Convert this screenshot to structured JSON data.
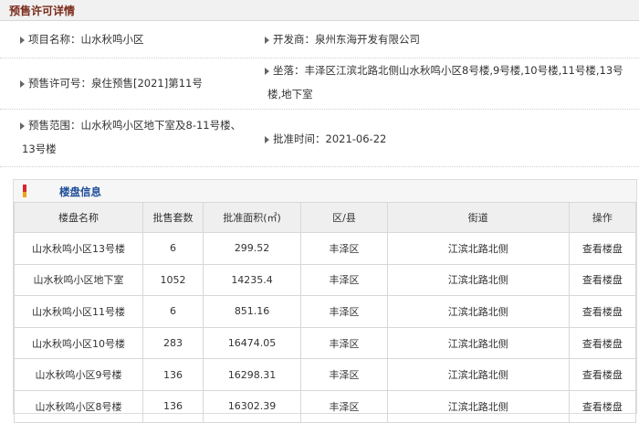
{
  "header": {
    "title": "预售许可详情"
  },
  "details": {
    "project_name_label": "项目名称：",
    "project_name": "山水秋鸣小区",
    "developer_label": "开发商：",
    "developer": "泉州东海开发有限公司",
    "permit_no_label": "预售许可号：",
    "permit_no": "泉住预售[2021]第11号",
    "location_label": "坐落：",
    "location_line1": "丰泽区江滨北路北侧山水秋鸣小区8号楼,9号楼,10号楼,11号楼,13号",
    "location_line2": "楼,地下室",
    "scope_label": "预售范围：",
    "scope_line1": "山水秋鸣小区地下室及8-11号楼、",
    "scope_line2": "13号楼",
    "approval_label": "批准时间：",
    "approval_date": "2021-06-22"
  },
  "listing": {
    "title": "楼盘信息",
    "columns": [
      "楼盘名称",
      "批售套数",
      "批准面积(㎡)",
      "区/县",
      "街道",
      "操作"
    ],
    "rows": [
      {
        "name": "山水秋鸣小区13号楼",
        "units": "6",
        "area": "299.52",
        "district": "丰泽区",
        "street": "江滨北路北侧",
        "action": "查看楼盘"
      },
      {
        "name": "山水秋鸣小区地下室",
        "units": "1052",
        "area": "14235.4",
        "district": "丰泽区",
        "street": "江滨北路北侧",
        "action": "查看楼盘"
      },
      {
        "name": "山水秋鸣小区11号楼",
        "units": "6",
        "area": "851.16",
        "district": "丰泽区",
        "street": "江滨北路北侧",
        "action": "查看楼盘"
      },
      {
        "name": "山水秋鸣小区10号楼",
        "units": "283",
        "area": "16474.05",
        "district": "丰泽区",
        "street": "江滨北路北侧",
        "action": "查看楼盘"
      },
      {
        "name": "山水秋鸣小区9号楼",
        "units": "136",
        "area": "16298.31",
        "district": "丰泽区",
        "street": "江滨北路北侧",
        "action": "查看楼盘"
      },
      {
        "name": "山水秋鸣小区8号楼",
        "units": "136",
        "area": "16302.39",
        "district": "丰泽区",
        "street": "江滨北路北侧",
        "action": "查看楼盘"
      }
    ]
  },
  "colors": {
    "title": "#7a2a1a",
    "section_title": "#1f4f9a",
    "icon_red": "#d6262b",
    "icon_orange": "#f0a020"
  }
}
